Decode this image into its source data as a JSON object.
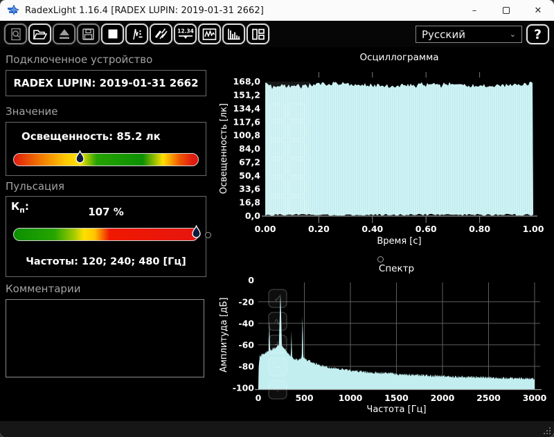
{
  "window": {
    "title": "RadexLight 1.16.4 [RADEX LUPIN: 2019-01-31 2662]"
  },
  "icons": {
    "minimize": "–",
    "close": "✕"
  },
  "toolbar": {
    "numeric_icon_label": "12.34",
    "language": {
      "value": "Русский"
    },
    "help_label": "?",
    "icons": [
      "zoom-preview-icon",
      "open-file-icon",
      "eject-device-icon",
      "save-icon",
      "stop-icon",
      "record-icon",
      "calibration-icon",
      "numeric-display-icon",
      "oscillogram-view-icon",
      "spectrum-view-icon",
      "layout-view-icon"
    ]
  },
  "device_panel": {
    "header": "Подключенное устройство",
    "device": "RADEX LUPIN: 2019-01-31 2662"
  },
  "value_panel": {
    "header": "Значение",
    "reading": "Освещенность: 85.2 лк",
    "marker_pos_pct": 38
  },
  "pulsation_panel": {
    "header": "Пульсация",
    "kp_main": "К",
    "kp_sub": "п",
    "kp_colon": ":",
    "kp_value": "107 %",
    "marker_pos_pct": 99,
    "frequencies": "Частоты: 120; 240; 480 [Гц]"
  },
  "comments_panel": {
    "header": "Комментарии",
    "text": ""
  },
  "colors": {
    "waveform_fill": "#c2eef0",
    "grid": "#5f5f5f",
    "axis": "#9a9a9a",
    "gauge_good": "#129500",
    "gauge_warn": "#ffdf00",
    "gauge_bad": "#e41d10",
    "marker_fill": "#0b1b3a"
  },
  "chart_data": [
    {
      "id": "oscillogram",
      "type": "area",
      "title": "Осциллограмма",
      "xlabel": "Время [с]",
      "ylabel": "Освещенность [лк]",
      "xlim": [
        0,
        1
      ],
      "ylim": [
        0,
        168
      ],
      "xtick_labels": [
        "0.00",
        "0.20",
        "0.40",
        "0.60",
        "0.80",
        "1.00"
      ],
      "ytick_labels": [
        "168,0",
        "151,2",
        "134,4",
        "117,6",
        "100,8",
        "84,0",
        "67,2",
        "50,4",
        "33,6",
        "16,8",
        "0,0"
      ],
      "grid": false,
      "legend": false,
      "series": [
        {
          "name": "Освещенность",
          "description": "Dense 120 Hz flicker waveform sampled over 0–1 s; oscillates between ~0 and ~168 lx so the fill covers nearly the whole plot",
          "envelope_top_lx": [
            158,
            168
          ],
          "envelope_bottom_lx": [
            0,
            3
          ]
        }
      ]
    },
    {
      "id": "spectrum",
      "type": "area",
      "title": "Спектр",
      "xlabel": "Частота [Гц]",
      "ylabel": "Амплитуда [дБ]",
      "xlim": [
        0,
        3000
      ],
      "ylim": [
        -100,
        0
      ],
      "xtick_labels": [
        "0",
        "500",
        "1000",
        "1500",
        "2000",
        "2500",
        "3000"
      ],
      "ytick_labels": [
        "0",
        "-20",
        "-40",
        "-60",
        "-80",
        "-100"
      ],
      "grid": true,
      "legend": false,
      "peaks_hz_db": [
        [
          120,
          -38
        ],
        [
          240,
          -12
        ],
        [
          360,
          -47
        ],
        [
          480,
          -34
        ]
      ],
      "noise_floor_hz_db": [
        [
          0,
          -100
        ],
        [
          5,
          -78
        ],
        [
          15,
          -71
        ],
        [
          40,
          -69
        ],
        [
          80,
          -67
        ],
        [
          130,
          -65
        ],
        [
          180,
          -63
        ],
        [
          230,
          -61
        ],
        [
          280,
          -63
        ],
        [
          330,
          -69
        ],
        [
          380,
          -73
        ],
        [
          430,
          -74
        ],
        [
          480,
          -72
        ],
        [
          530,
          -74
        ],
        [
          600,
          -77
        ],
        [
          700,
          -80
        ],
        [
          850,
          -82
        ],
        [
          1000,
          -84
        ],
        [
          1200,
          -85.5
        ],
        [
          1500,
          -87
        ],
        [
          1800,
          -88.5
        ],
        [
          2100,
          -89.5
        ],
        [
          2500,
          -90.5
        ],
        [
          3000,
          -91.5
        ]
      ]
    }
  ]
}
